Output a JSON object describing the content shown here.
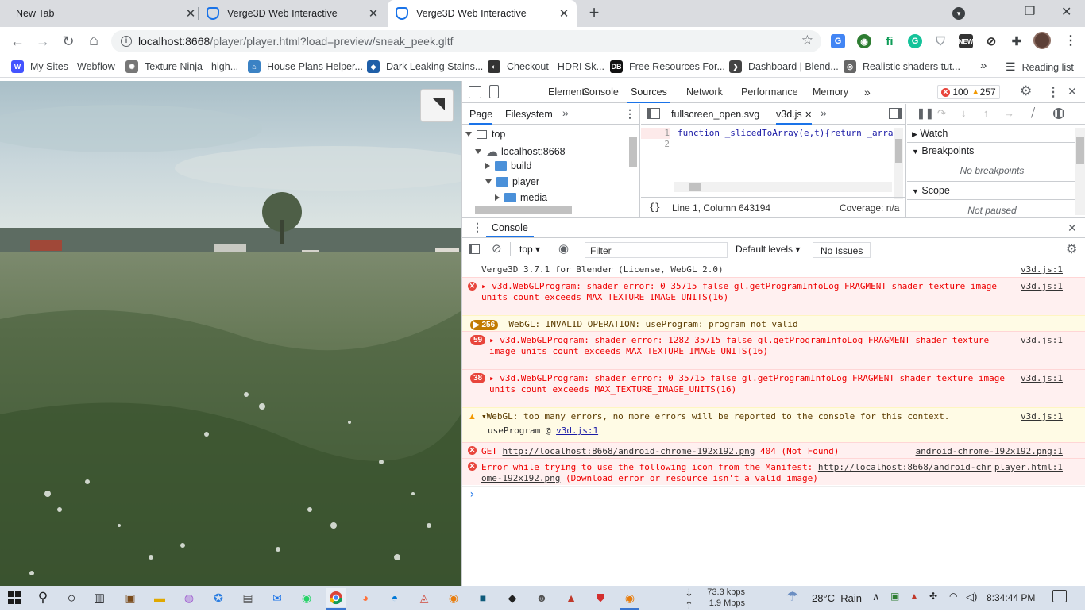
{
  "tabs": [
    {
      "title": "New Tab",
      "active": false
    },
    {
      "title": "Verge3D Web Interactive",
      "active": false
    },
    {
      "title": "Verge3D Web Interactive",
      "active": true
    }
  ],
  "new_tab_label": "+",
  "window_controls": {
    "minimize": "—",
    "maximize": "❐",
    "close": "✕"
  },
  "address": {
    "host": "localhost:8668",
    "path": "/player/player.html?load=preview/sneak_peek.gltf"
  },
  "bookmarks": [
    {
      "label": "My Sites - Webflow",
      "icon": "webflow-icon",
      "color": "#4353ff",
      "glyph": "W"
    },
    {
      "label": "Texture Ninja - high...",
      "icon": "ninja-icon",
      "color": "#777777",
      "glyph": "✺"
    },
    {
      "label": "House Plans Helper...",
      "icon": "house-icon",
      "color": "#3b82c4",
      "glyph": "⌂"
    },
    {
      "label": "Dark Leaking Stains...",
      "icon": "cube-icon",
      "color": "#1f5fa8",
      "glyph": "◆"
    },
    {
      "label": "Checkout - HDRI Sk...",
      "icon": "hdri-icon",
      "color": "#333333",
      "glyph": "◐"
    },
    {
      "label": "Free Resources For...",
      "icon": "db-icon",
      "color": "#111111",
      "glyph": "DB"
    },
    {
      "label": "Dashboard | Blend...",
      "icon": "blend-icon",
      "color": "#444444",
      "glyph": "❯"
    },
    {
      "label": "Realistic shaders tut...",
      "icon": "globe-icon",
      "color": "#666666",
      "glyph": "◎"
    }
  ],
  "bookmarks_more": "»",
  "reading_list": "Reading list",
  "devtools": {
    "main_tabs": [
      "Elements",
      "Console",
      "Sources",
      "Network",
      "Performance",
      "Memory"
    ],
    "selected_tab": "Sources",
    "error_count": "100",
    "warning_count": "257",
    "nav_tabs": [
      "Page",
      "Filesystem"
    ],
    "tree": [
      {
        "label": "top",
        "level": 0,
        "kind": "frame",
        "open": true
      },
      {
        "label": "localhost:8668",
        "level": 1,
        "kind": "cloud",
        "open": true
      },
      {
        "label": "build",
        "level": 2,
        "kind": "folder",
        "open": false
      },
      {
        "label": "player",
        "level": 2,
        "kind": "folder",
        "open": true
      },
      {
        "label": "media",
        "level": 3,
        "kind": "folder",
        "open": false
      }
    ],
    "editor_tabs": [
      "fullscreen_open.svg",
      "v3d.js"
    ],
    "editor_active": "v3d.js",
    "code_lines": [
      "function _slicedToArray(e,t){return _arra",
      ""
    ],
    "line_numbers": [
      "1",
      "2"
    ],
    "status": {
      "format": "{}",
      "position": "Line 1, Column 643194",
      "coverage": "Coverage: n/a"
    },
    "debugger": {
      "watch": "Watch",
      "breakpoints": "Breakpoints",
      "no_breakpoints": "No breakpoints",
      "scope": "Scope",
      "not_paused": "Not paused"
    },
    "drawer_tab": "Console",
    "console_toolbar": {
      "context": "top",
      "filter_placeholder": "Filter",
      "levels": "Default levels",
      "issues": "No Issues"
    },
    "console": [
      {
        "kind": "info",
        "text": "Verge3D 3.7.1 for Blender (License, WebGL 2.0)",
        "source": "v3d.js:1"
      },
      {
        "kind": "error",
        "lines": [
          "▸ v3d.WebGLProgram: shader error:  0 35715 false gl.getProgramInfoLog FRAGMENT shader texture image",
          "units count exceeds MAX_TEXTURE_IMAGE_UNITS(16)"
        ],
        "source": "v3d.js:1"
      },
      {
        "kind": "warn",
        "count": "256",
        "text": "WebGL: INVALID_OPERATION: useProgram: program not valid"
      },
      {
        "kind": "error",
        "count": "59",
        "lines": [
          "▸ v3d.WebGLProgram: shader error:  1282 35715 false gl.getProgramInfoLog FRAGMENT shader texture",
          "image units count exceeds MAX_TEXTURE_IMAGE_UNITS(16)"
        ],
        "source": "v3d.js:1"
      },
      {
        "kind": "error",
        "count": "38",
        "lines": [
          "▸ v3d.WebGLProgram: shader error:  0 35715 false gl.getProgramInfoLog FRAGMENT shader texture image",
          "units count exceeds MAX_TEXTURE_IMAGE_UNITS(16)"
        ],
        "source": "v3d.js:1"
      },
      {
        "kind": "warn",
        "lines": [
          "▾WebGL: too many errors, no more errors will be reported to the console for this context.",
          "useProgram @ "
        ],
        "link": "v3d.js:1",
        "source": "v3d.js:1"
      },
      {
        "kind": "error",
        "text_prefix": "GET ",
        "url": "http://localhost:8668/android-chrome-192x192.png",
        "text_suffix": " 404 (Not Found)",
        "source": "android-chrome-192x192.png:1"
      },
      {
        "kind": "error",
        "text_prefix": "Error while trying to use the following icon from the Manifest: ",
        "url": "http://localhost:8668/android-chr",
        "line2_url": "ome-192x192.png",
        "line2_suffix": " (Download error or resource isn't a valid image)",
        "source": "player.html:1"
      }
    ],
    "prompt": "›"
  },
  "taskbar": {
    "network_down": "73.3 kbps",
    "network_up": "1.9 Mbps",
    "weather": "28°C  Rain",
    "time": "8:34:44 PM"
  },
  "colors": {
    "accent": "#1a73e8",
    "error": "#e00000",
    "warn_badge": "#c27a00"
  }
}
